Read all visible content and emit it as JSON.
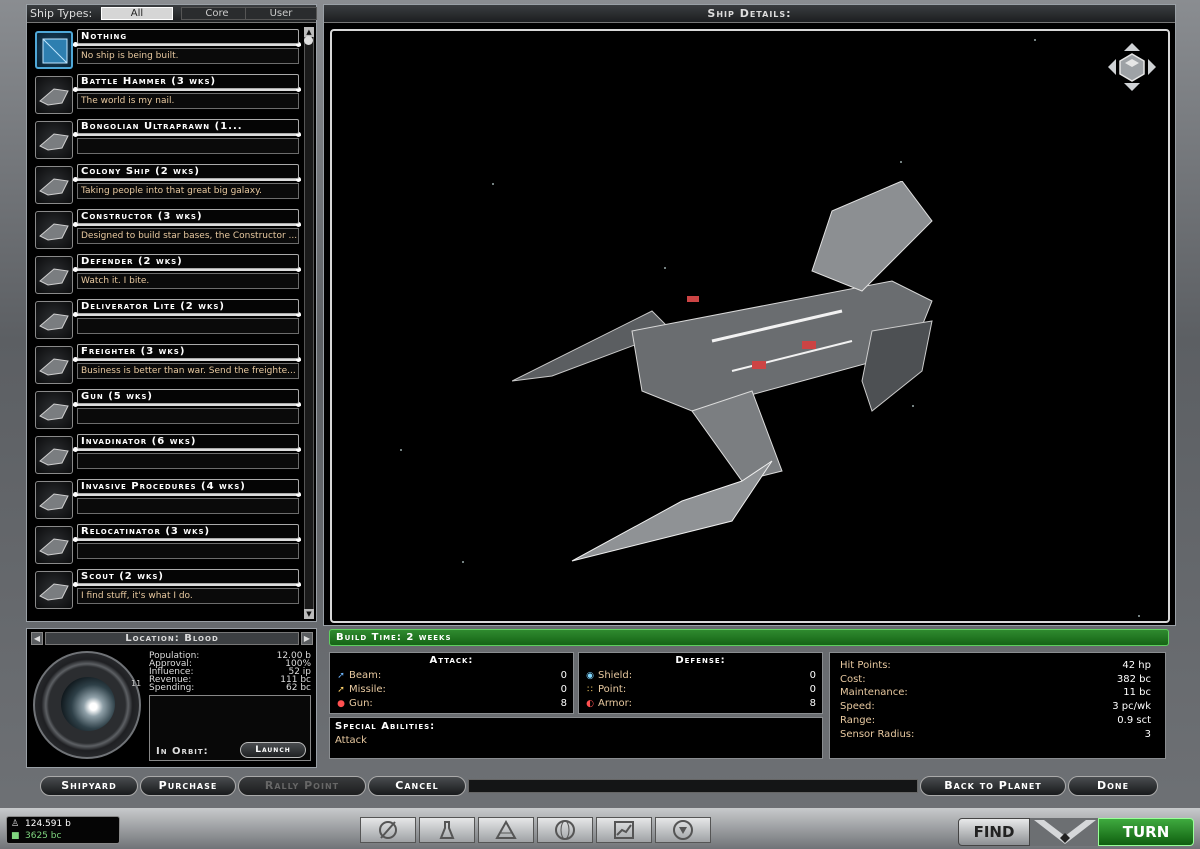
{
  "ship_types": {
    "label": "Ship Types:",
    "tabs": [
      "All",
      "Core",
      "User"
    ],
    "active": "All"
  },
  "ships": [
    {
      "name": "Nothing",
      "desc": "No ship is being built.",
      "selected": true
    },
    {
      "name": "Battle Hammer (3 wks)",
      "desc": "The world is my nail."
    },
    {
      "name": "Bongolian Ultraprawn (1...",
      "desc": ""
    },
    {
      "name": "Colony Ship (2 wks)",
      "desc": "Taking people into that great big galaxy."
    },
    {
      "name": "Constructor (3 wks)",
      "desc": "Designed to build star bases, the Constructor ..."
    },
    {
      "name": "Defender (2 wks)",
      "desc": "Watch it. I bite."
    },
    {
      "name": "Deliverator Lite (2 wks)",
      "desc": ""
    },
    {
      "name": "Freighter (3 wks)",
      "desc": "Business is better than war. Send the freighte..."
    },
    {
      "name": "Gun (5 wks)",
      "desc": ""
    },
    {
      "name": "Invadinator (6 wks)",
      "desc": ""
    },
    {
      "name": "Invasive Procedures (4 wks)",
      "desc": ""
    },
    {
      "name": "Relocatinator (3 wks)",
      "desc": ""
    },
    {
      "name": "Scout (2 wks)",
      "desc": "I find stuff, it's what I do."
    }
  ],
  "location": {
    "title": "Location: Blood",
    "planet_number": "11",
    "stats": [
      {
        "label": "Population:",
        "value": "12.00 b"
      },
      {
        "label": "Approval:",
        "value": "100%"
      },
      {
        "label": "Influence:",
        "value": "52 ip"
      },
      {
        "label": "Revenue:",
        "value": "111 bc"
      },
      {
        "label": "Spending:",
        "value": "62 bc"
      }
    ],
    "orbit_label": "In Orbit:",
    "launch_label": "Launch"
  },
  "details": {
    "title": "Ship Details:",
    "build_time": "Build Time: 2 weeks"
  },
  "attack": {
    "title": "Attack:",
    "rows": [
      {
        "label": "Beam:",
        "value": "0",
        "icon": "beam-icon"
      },
      {
        "label": "Missile:",
        "value": "0",
        "icon": "missile-icon"
      },
      {
        "label": "Gun:",
        "value": "8",
        "icon": "gun-icon"
      }
    ]
  },
  "defense": {
    "title": "Defense:",
    "rows": [
      {
        "label": "Shield:",
        "value": "0",
        "icon": "shield-icon"
      },
      {
        "label": "Point:",
        "value": "0",
        "icon": "point-defense-icon"
      },
      {
        "label": "Armor:",
        "value": "8",
        "icon": "armor-icon"
      }
    ]
  },
  "special": {
    "title": "Special Abilities:",
    "value": "Attack"
  },
  "stats": [
    {
      "label": "Hit Points:",
      "value": "42 hp"
    },
    {
      "label": "Cost:",
      "value": "382 bc"
    },
    {
      "label": "Maintenance:",
      "value": "11 bc"
    },
    {
      "label": "Speed:",
      "value": "3 pc/wk"
    },
    {
      "label": "Range:",
      "value": "0.9 sct"
    },
    {
      "label": "Sensor Radius:",
      "value": "3"
    }
  ],
  "nav": {
    "shipyard": "Shipyard",
    "purchase": "Purchase",
    "rally_point": "Rally Point",
    "cancel": "Cancel",
    "back_to_planet": "Back to Planet",
    "done": "Done"
  },
  "footer": {
    "credits": "124.591 b",
    "income": "3625 bc",
    "find": "FIND",
    "turn": "TURN",
    "icons": [
      "government-icon",
      "research-icon",
      "planets-icon",
      "galaxy-icon",
      "graphs-icon",
      "races-icon"
    ]
  },
  "colors": {
    "accent_green": "#2f8a2f",
    "desc_text": "#e8c9a0",
    "selection_blue": "#4fa8d8"
  }
}
